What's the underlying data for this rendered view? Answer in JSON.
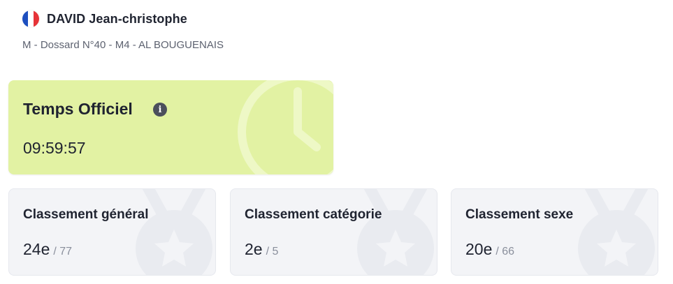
{
  "athlete": {
    "name": "DAVID Jean-christophe",
    "details": "M - Dossard N°40 - M4 - AL BOUGUENAIS",
    "flag_colors": [
      "#1d4fbf",
      "#ffffff",
      "#e63338"
    ]
  },
  "official_time": {
    "title": "Temps Officiel",
    "info_icon": "info-icon",
    "background_icon": "clock-icon",
    "time": "09:59:57",
    "color": "#e2f2a3"
  },
  "rankings": [
    {
      "title": "Classement général",
      "rank": "24e",
      "total": "/ 77",
      "icon": "medal-icon"
    },
    {
      "title": "Classement catégorie",
      "rank": "2e",
      "total": "/ 5",
      "icon": "medal-icon"
    },
    {
      "title": "Classement sexe",
      "rank": "20e",
      "total": "/ 66",
      "icon": "medal-icon"
    }
  ]
}
